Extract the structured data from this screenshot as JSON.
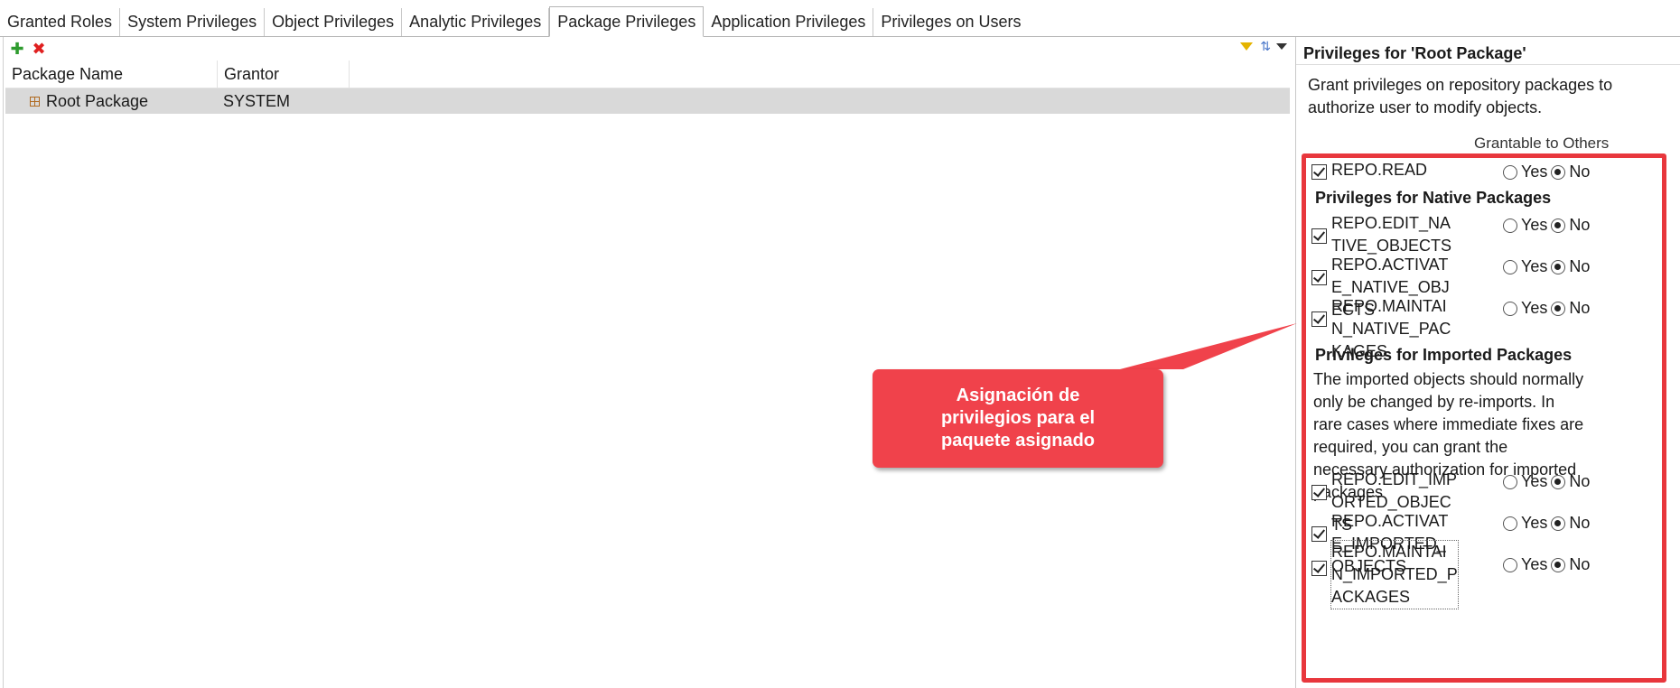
{
  "tabs": [
    {
      "label": "Granted Roles",
      "active": false
    },
    {
      "label": "System Privileges",
      "active": false
    },
    {
      "label": "Object Privileges",
      "active": false
    },
    {
      "label": "Analytic Privileges",
      "active": false
    },
    {
      "label": "Package Privileges",
      "active": true
    },
    {
      "label": "Application Privileges",
      "active": false
    },
    {
      "label": "Privileges on Users",
      "active": false
    }
  ],
  "toolbar": {
    "add_icon": "add-icon",
    "delete_icon": "delete-icon",
    "filter_icon": "filter-icon",
    "sort_icon": "sort-icon",
    "menu_icon": "view-menu-icon"
  },
  "table": {
    "columns": [
      "Package Name",
      "Grantor"
    ],
    "rows": [
      {
        "package_name": "Root Package",
        "grantor": "SYSTEM",
        "selected": true
      }
    ]
  },
  "details": {
    "title": "Privileges for 'Root Package'",
    "description": "Grant privileges on repository packages to authorize user to modify objects.",
    "grantable_header": "Grantable to Others",
    "yes_label": "Yes",
    "no_label": "No",
    "read_privilege": {
      "name": "REPO.READ",
      "checked": true,
      "grantable": "No"
    },
    "native_section": "Privileges for Native Packages",
    "native_privileges": [
      {
        "name": "REPO.EDIT_NATIVE_OBJECTS",
        "checked": true,
        "grantable": "No"
      },
      {
        "name": "REPO.ACTIVATE_NATIVE_OBJECTS",
        "checked": true,
        "grantable": "No"
      },
      {
        "name": "REPO.MAINTAIN_NATIVE_PACKAGES",
        "checked": true,
        "grantable": "No"
      }
    ],
    "imported_section": "Privileges for Imported Packages",
    "imported_note": "The imported objects should normally only be changed by re-imports. In rare cases where immediate fixes are required, you can grant the necessary authorization for imported packages",
    "imported_privileges": [
      {
        "name": "REPO.EDIT_IMPORTED_OBJECTS",
        "checked": true,
        "grantable": "No"
      },
      {
        "name": "REPO.ACTIVATE_IMPORTED_OBJECTS",
        "checked": true,
        "grantable": "No"
      },
      {
        "name": "REPO.MAINTAIN_IMPORTED_PACKAGES",
        "checked": true,
        "grantable": "No"
      }
    ]
  },
  "callout": {
    "text": "Asignación de privilegios para el paquete asignado",
    "color": "#f0424b"
  },
  "colors": {
    "highlight_border": "#e8373d",
    "selected_row": "#d9d9d9"
  }
}
